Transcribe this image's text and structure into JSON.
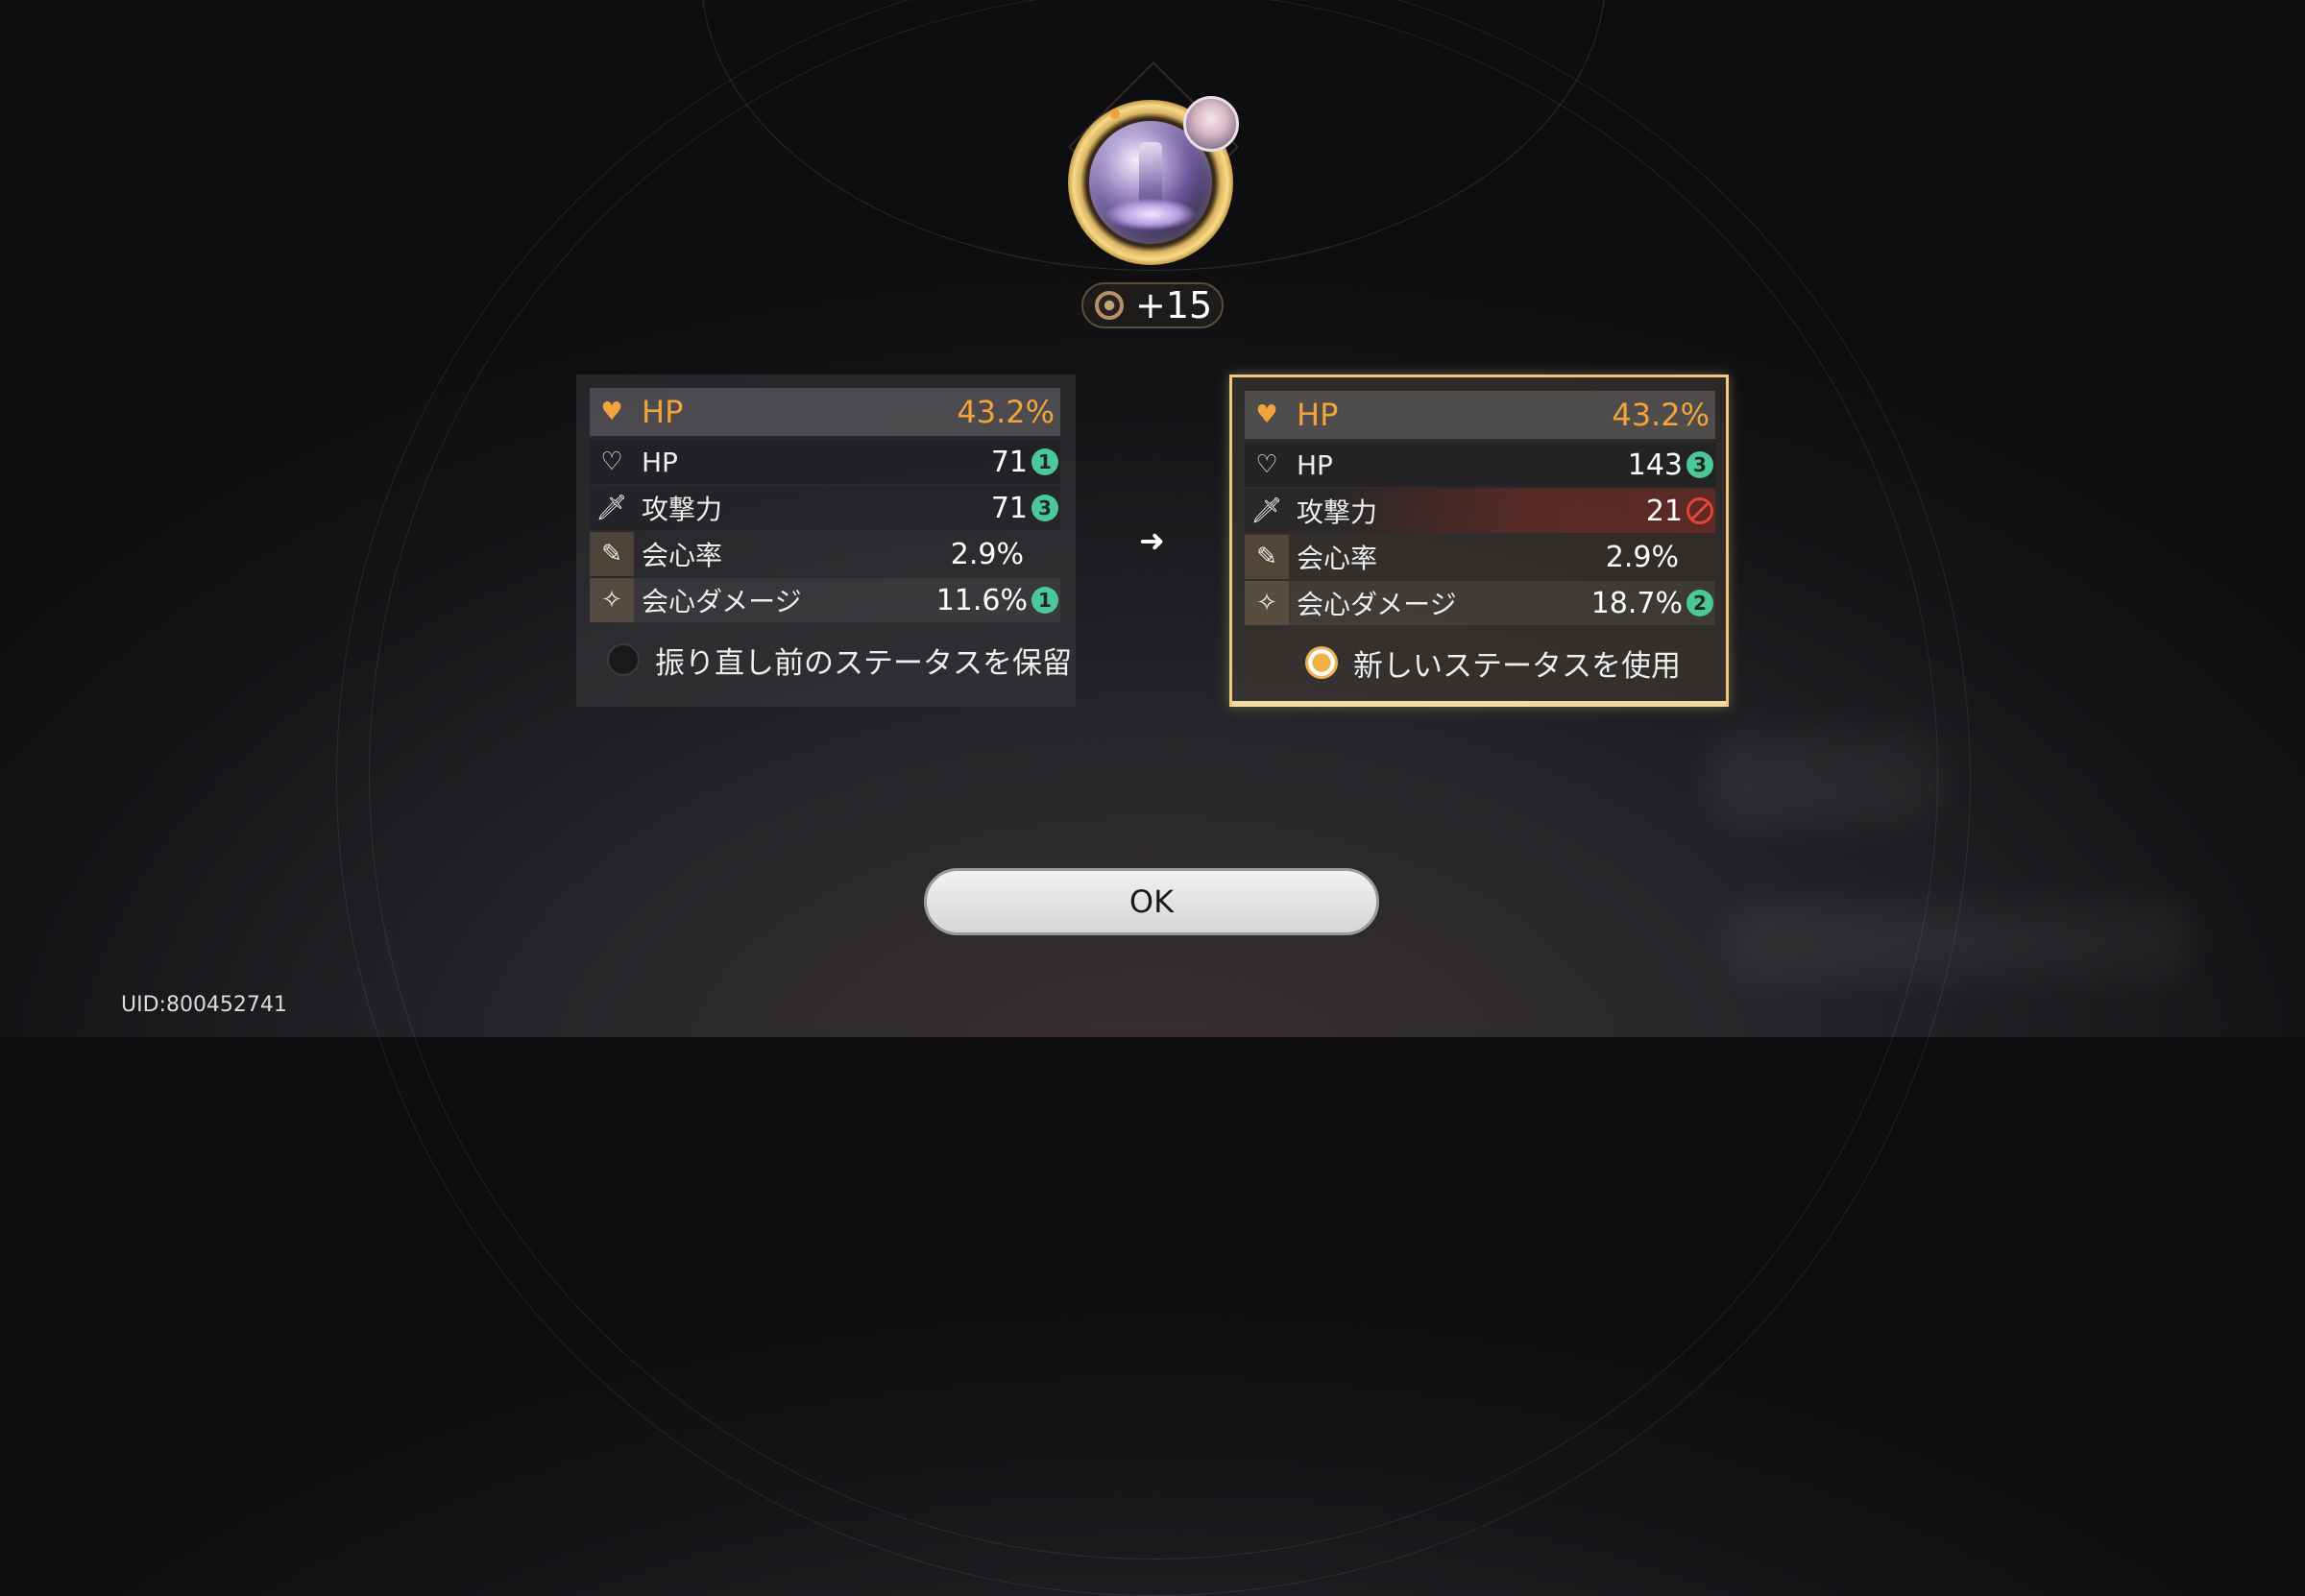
{
  "echo": {
    "level_text": "+15"
  },
  "current": {
    "main_stat": {
      "name": "HP",
      "value": "43.2%"
    },
    "sub_stats": [
      {
        "name": "HP",
        "value": "71",
        "badge": "1"
      },
      {
        "name": "攻撃力",
        "value": "71",
        "badge": "3"
      },
      {
        "name": "会心率",
        "value": "2.9%",
        "badge": ""
      },
      {
        "name": "会心ダメージ",
        "value": "11.6%",
        "badge": "1"
      }
    ],
    "option_label": "振り直し前のステータスを保留"
  },
  "new": {
    "main_stat": {
      "name": "HP",
      "value": "43.2%"
    },
    "sub_stats": [
      {
        "name": "HP",
        "value": "143",
        "badge": "3"
      },
      {
        "name": "攻撃力",
        "value": "21",
        "badge": "blocked"
      },
      {
        "name": "会心率",
        "value": "2.9%",
        "badge": ""
      },
      {
        "name": "会心ダメージ",
        "value": "18.7%",
        "badge": "2"
      }
    ],
    "option_label": "新しいステータスを使用"
  },
  "selected_option": "new",
  "ok_label": "OK",
  "uid_text": "UID:800452741",
  "colors": {
    "accent": "#f2a43a",
    "badge": "#4cc79a",
    "selected_border": "#f0c880",
    "reduced": "#e0453a"
  },
  "icons": {
    "main": "heart-icon",
    "hp": "heart-icon",
    "atk": "sword-icon",
    "crit_rate": "crit-rate-icon",
    "crit_dmg": "crit-damage-icon",
    "arrow": "arrow-right-icon"
  }
}
